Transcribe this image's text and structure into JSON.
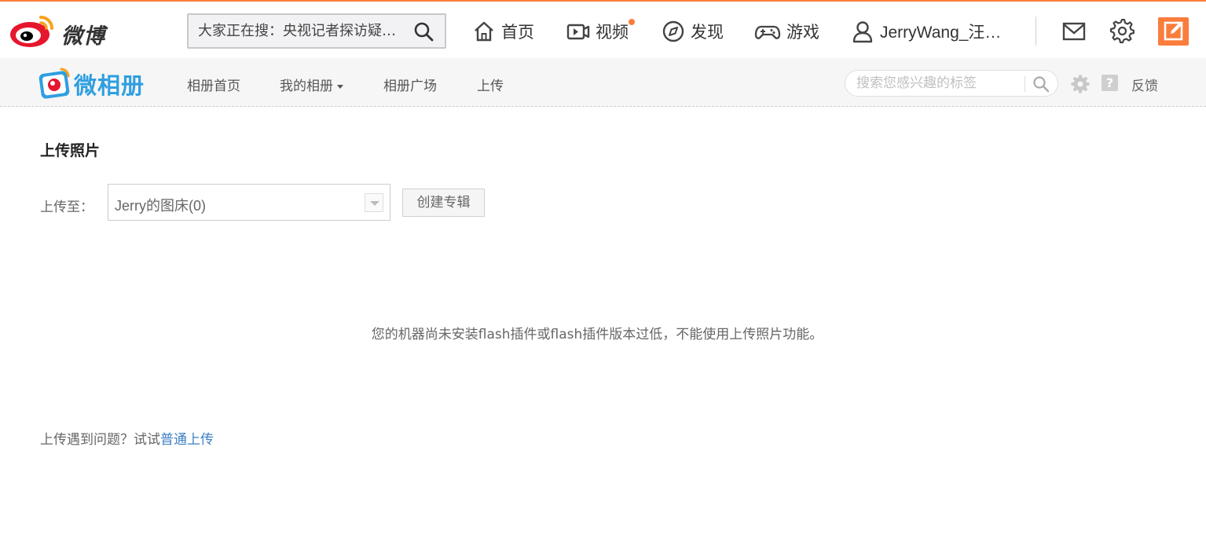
{
  "header": {
    "logo_text": "微博",
    "search_placeholder": "大家正在搜：央视记者探访疑…",
    "nav": {
      "home": "首页",
      "video": "视频",
      "discover": "发现",
      "game": "游戏",
      "user": "JerryWang_汪…"
    }
  },
  "subheader": {
    "logo_text": "微相册",
    "nav": {
      "album_home": "相册首页",
      "my_album": "我的相册",
      "album_square": "相册广场",
      "upload": "上传"
    },
    "tag_search_placeholder": "搜索您感兴趣的标签",
    "help_label": "?",
    "feedback": "反馈"
  },
  "main": {
    "title": "上传照片",
    "upload_to_label": "上传至：",
    "album_selected": "Jerry的图床(0)",
    "create_album_button": "创建专辑",
    "flash_message": "您的机器尚未安装flash插件或flash插件版本过低，不能使用上传照片功能。",
    "trouble_text": "上传遇到问题？试试",
    "trouble_link": "普通上传"
  },
  "colors": {
    "accent": "#fa7d3c",
    "album_blue": "#2f9fe0",
    "link": "#3d7fc4"
  }
}
